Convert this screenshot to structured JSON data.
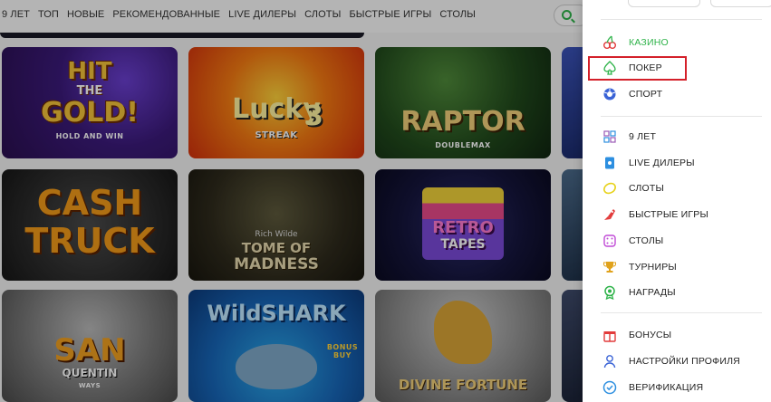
{
  "topnav": {
    "links": [
      "9 ЛЕТ",
      "ТОП",
      "НОВЫЕ",
      "РЕКОМЕНДОВАННЫЕ",
      "LIVE ДИЛЕРЫ",
      "СЛОТЫ",
      "БЫСТРЫЕ ИГРЫ",
      "СТОЛЫ"
    ]
  },
  "games": {
    "hit_the_gold": {
      "line1": "HIT",
      "line2": "THE",
      "line3": "GOLD!",
      "sub": "HOLD AND WIN"
    },
    "lucky_streak": {
      "line1": "Lucky",
      "num": "3",
      "sub": "STREAK"
    },
    "raptor": {
      "line1": "RAPTOR",
      "sub": "DOUBLEMAX"
    },
    "cash_truck": {
      "line1": "CASH",
      "line2": "TRUCK"
    },
    "tome_of_madness": {
      "line0": "Rich Wilde",
      "line1": "TOME OF",
      "line2": "MADNESS"
    },
    "retro_tapes": {
      "line1": "RETRO",
      "line2": "TAPES"
    },
    "san_quentin": {
      "line1": "SAN",
      "line2": "QUENTIN",
      "sub": "WAYS"
    },
    "wild_shark": {
      "line1": "WildSHARK",
      "sub": "BONUS BUY"
    },
    "divine_fortune": {
      "line1": "DIVINE FORTUNE"
    }
  },
  "menu": {
    "items": [
      {
        "label": "КАЗИНО",
        "icon": "cherries-icon",
        "color": "#e23b3b"
      },
      {
        "label": "ПОКЕР",
        "icon": "spade-icon",
        "color": "#2fb34a"
      },
      {
        "label": "СПОРТ",
        "icon": "ball-icon",
        "color": "#3a63d6"
      },
      {
        "label": "9 ЛЕТ",
        "icon": "gift-icon",
        "color": "#9b59b6"
      },
      {
        "label": "LIVE ДИЛЕРЫ",
        "icon": "live-card-icon",
        "color": "#2d8fe0"
      },
      {
        "label": "СЛОТЫ",
        "icon": "lemon-icon",
        "color": "#e7d21c"
      },
      {
        "label": "БЫСТРЫЕ ИГРЫ",
        "icon": "rocket-icon",
        "color": "#e23b3b"
      },
      {
        "label": "СТОЛЫ",
        "icon": "dice-icon",
        "color": "#c04ad6"
      },
      {
        "label": "ТУРНИРЫ",
        "icon": "trophy-icon",
        "color": "#e0a21c"
      },
      {
        "label": "НАГРАДЫ",
        "icon": "badge-icon",
        "color": "#2fb34a"
      },
      {
        "label": "БОНУСЫ",
        "icon": "gift-box-icon",
        "color": "#e23b3b"
      },
      {
        "label": "НАСТРОЙКИ ПРОФИЛЯ",
        "icon": "user-icon",
        "color": "#3a63d6"
      },
      {
        "label": "ВЕРИФИКАЦИЯ",
        "icon": "check-badge-icon",
        "color": "#2d8fe0"
      }
    ],
    "active_label": "КАЗИНО",
    "highlighted_label": "ПОКЕР"
  },
  "colors": {
    "accent": "#2fb34a",
    "highlight": "#d4202a"
  }
}
